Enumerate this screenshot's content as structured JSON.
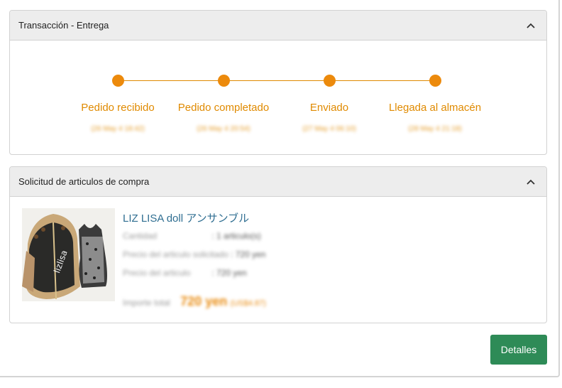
{
  "delivery": {
    "title": "Transacción - Entrega",
    "steps": [
      {
        "label": "Pedido recibido",
        "date": "(26 May 4 18:42)"
      },
      {
        "label": "Pedido completado",
        "date": "(26 May 4 20:54)"
      },
      {
        "label": "Enviado",
        "date": "(27 May 4 06:10)"
      },
      {
        "label": "Llegada al almacén",
        "date": "(28 May 4 21:18)"
      }
    ]
  },
  "items": {
    "title": "Solicitud de articulos de compra",
    "product_name": "LIZ LISA doll アンサンブル",
    "quantity_label": "Cantidad",
    "quantity_value": ": 1 articulo(s)",
    "requested_price_label": "Precio del articulo solicitado",
    "requested_price_value": ": 720 yen",
    "price_label": "Precio del articulo",
    "price_value": ": 720 yen",
    "total_label": "Importe total",
    "total_value": "720 yen",
    "total_sub": "(US$4.87)"
  },
  "actions": {
    "details_label": "Detalles"
  },
  "colors": {
    "accent_orange": "#ec8a0c",
    "link_blue": "#2f6e91",
    "button_green": "#2e8b57"
  },
  "icons": {
    "collapse": "chevron-up-icon"
  }
}
